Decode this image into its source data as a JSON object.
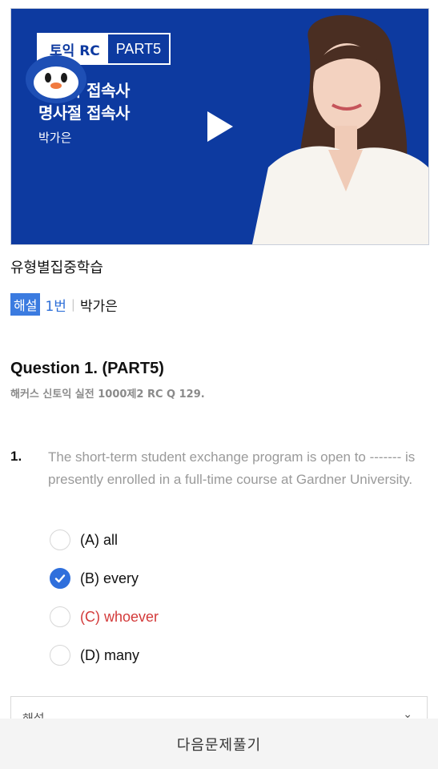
{
  "video": {
    "badge_left": "토익 RC",
    "badge_right": "PART5",
    "title_line1": "명사와 접속사",
    "title_line2": "명사절 접속사",
    "instructor": "박가은"
  },
  "section_title": "유형별집중학습",
  "meta": {
    "tag": "해설",
    "number": "1번",
    "separator": "|",
    "name": "박가은"
  },
  "question": {
    "title": "Question 1. (PART5)",
    "source": "해커스 신토익 실전 1000제2 RC Q 129.",
    "number": "1.",
    "text": "The short-term student exchange program is open to ------- is presently enrolled in a full-time course at Gardner University.",
    "options": [
      {
        "label": "(A) all",
        "state": "unselected"
      },
      {
        "label": "(B) every",
        "state": "selected"
      },
      {
        "label": "(C) whoever",
        "state": "correct-answer"
      },
      {
        "label": "(D) many",
        "state": "unselected"
      }
    ]
  },
  "explanation": {
    "label": "해설"
  },
  "next_button": "다음문제풀기",
  "colors": {
    "video_bg": "#0d3aa0",
    "accent_blue": "#2f6fdc",
    "wrong_red": "#d33a3a"
  }
}
